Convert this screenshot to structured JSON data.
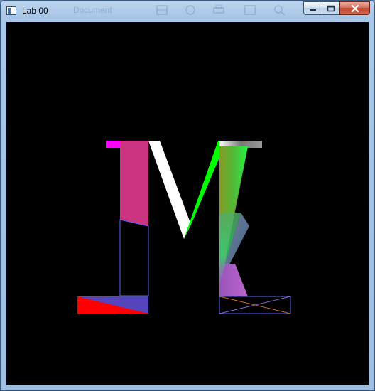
{
  "window": {
    "title": "Lab 00",
    "background_title_text": "Document",
    "controls": {
      "minimize_icon": "minimize-icon",
      "maximize_icon": "maximize-icon",
      "close_icon": "close-icon"
    }
  },
  "canvas": {
    "background_color": "#000000",
    "shape_colors": {
      "magenta": "#ff00ff",
      "pink": "#cc3380",
      "white": "#ffffff",
      "green": "#00ff00",
      "red": "#ff0000",
      "purple": "#5544bb",
      "blue_outline": "#5566ff",
      "orange_line": "#cc6622",
      "grey_bar": "#888888"
    }
  }
}
